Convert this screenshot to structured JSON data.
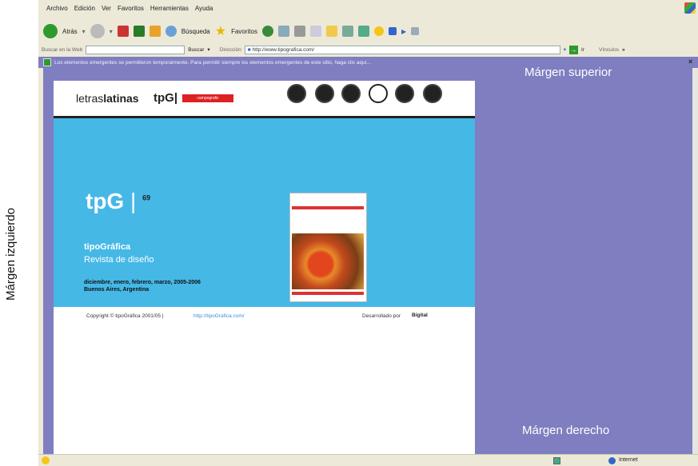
{
  "left_margin_label": "Márgen izquierdo",
  "top_margin_label": "Márgen superior",
  "right_margin_label": "Márgen derecho",
  "menu": [
    "Archivo",
    "Edición",
    "Ver",
    "Favoritos",
    "Herramientas",
    "Ayuda"
  ],
  "toolbar": {
    "back_label": "Atrás",
    "search_label": "Búsqueda",
    "favorites_label": "Favoritos"
  },
  "address_bar": {
    "web_search_label": "Buscar en la Web",
    "buscar_button": "Buscar",
    "address_label": "Dirección",
    "url": "http://www.tipografica.com/",
    "go_label": "Ir",
    "links_label": "Vínculos"
  },
  "infobar_text": "Los elementos emergentes se permitieron temporalmente. Para permitir siempre los elementos emergentes de este sitio, haga clic aquí...",
  "site": {
    "logo_letras_a": "letras",
    "logo_letras_b": "latinas",
    "logo_tpg": "tpG|",
    "logo_badge": "campografic",
    "big_title": "tpG",
    "issue_number": "69",
    "magazine_name": "tipoGráfica",
    "magazine_sub": "Revista de diseño",
    "dates": "diciembre, enero, febrero, marzo, 2005-2006",
    "location": "Buenos Aires, Argentina",
    "copyright": "Copyright © tipoGráfica 2001/05 |",
    "copyright_link": "http://tipoGrafica.com/",
    "developed_by": "Desarrollado por",
    "developer": "Bigital"
  },
  "status": {
    "zone": "Internet"
  },
  "colors": {
    "overlay": "#7f7ec0",
    "site_blue": "#45b8e6",
    "chrome": "#ece9d8"
  }
}
